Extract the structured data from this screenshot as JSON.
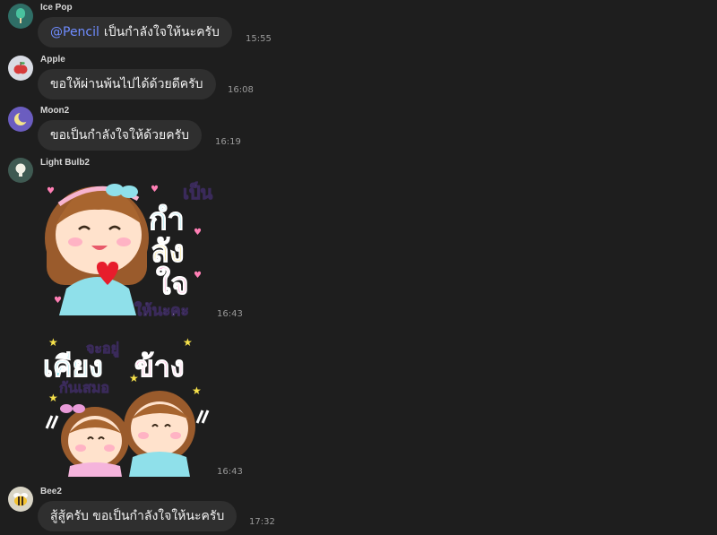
{
  "messages": [
    {
      "user": "Ice Pop",
      "mention": "@Pencil",
      "text": "เป็นกำลังใจให้นะครับ",
      "time": "15:55",
      "avatar_icon": "popsicle-icon",
      "avatar_bg": "#2f6e66"
    },
    {
      "user": "Apple",
      "text": "ขอให้ผ่านพ้นไปได้ด้วยดีครับ",
      "time": "16:08",
      "avatar_icon": "apple-icon",
      "avatar_bg": "#d9dce4"
    },
    {
      "user": "Moon2",
      "text": "ขอเป็นกำลังใจให้ด้วยครับ",
      "time": "16:19",
      "avatar_icon": "moon-icon",
      "avatar_bg": "#6b5dc0"
    },
    {
      "user": "Light Bulb2",
      "time": "16:43",
      "avatar_icon": "light-bulb-icon",
      "avatar_bg": "#3f5a52"
    },
    {
      "user": "Bee2",
      "text": "สู้สู้ครับ ขอเป็นกำลังใจให้นะครับ",
      "time": "17:32",
      "avatar_icon": "bee-icon",
      "avatar_bg": "#d9d5c6"
    }
  ],
  "stickers": [
    {
      "name": "cheer-sticker",
      "lines": [
        "เป็น",
        "กำ",
        "ลัง",
        "ใจ",
        "ให้นะคะ"
      ],
      "time": "16:43"
    },
    {
      "name": "together-sticker",
      "lines": [
        "จะอยู่",
        "เคียง",
        "ข้าง",
        "กันเสมอ"
      ],
      "time": "16:43"
    }
  ]
}
